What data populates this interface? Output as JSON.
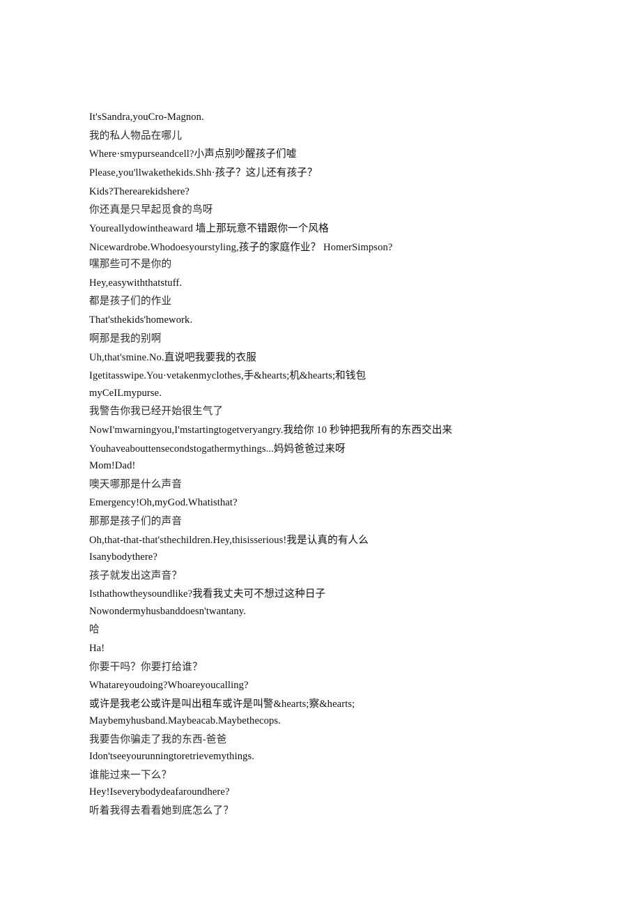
{
  "document": {
    "kind": "bilingual-subtitle-transcript",
    "page_background": "#ffffff",
    "text_color": "#000000",
    "lines": [
      {
        "text": "It'sSandra,youCro-Magnon.",
        "lang": "en",
        "style": "gap-tight"
      },
      {
        "text": "我的私人物品在哪儿",
        "lang": "zh",
        "style": "gap-loose"
      },
      {
        "text": "Where·smypurseandcell?小声点别吵醒孩子们嘘",
        "lang": "mix",
        "style": "gap-loose"
      },
      {
        "text": "Please,you'llwakethekids.Shh·孩子？这儿还有孩子？",
        "lang": "mix",
        "style": "gap-loose"
      },
      {
        "text": "Kids?Therearekidshere?",
        "lang": "en",
        "style": "gap-loose"
      },
      {
        "text": "你还真是只早起觅食的鸟呀",
        "lang": "zh",
        "style": "gap-loose"
      },
      {
        "text": "Youreallydowintheaward 墙上那玩意不错跟你一个风格",
        "lang": "mix",
        "style": "gap-loose"
      },
      {
        "text": "Nicewardrobe.Whodoesyourstyling,孩子的家庭作业？ HomerSimpson?",
        "lang": "mix",
        "style": "gap-loose"
      },
      {
        "text": "嘿那些可不是你的",
        "lang": "zh",
        "style": "gap-tight"
      },
      {
        "text": "Hey,easywiththatstuff.",
        "lang": "en",
        "style": "gap-loose"
      },
      {
        "text": "都是孩子们的作业",
        "lang": "zh",
        "style": "gap-loose"
      },
      {
        "text": "That'sthekids'homework.",
        "lang": "en",
        "style": "gap-loose"
      },
      {
        "text": "啊那是我的别啊",
        "lang": "zh",
        "style": "gap-loose"
      },
      {
        "text": "Uh,that'smine.No.直说吧我要我的衣服",
        "lang": "mix",
        "style": "gap-loose"
      },
      {
        "text": "Igetitasswipe.You·vetakenmyclothes,手&hearts;机&hearts;和钱包",
        "lang": "mix",
        "style": "gap-loose"
      },
      {
        "text": "myCeILmypurse.",
        "lang": "en",
        "style": "gap-tight"
      },
      {
        "text": "我警告你我已经开始很生气了",
        "lang": "zh",
        "style": "gap-loose"
      },
      {
        "text": "NowI'mwarningyou,I'mstartingtogetveryangry.我给你 10 秒钟把我所有的东西交出来",
        "lang": "mix",
        "style": "gap-loose"
      },
      {
        "text": "Youhaveabouttensecondstogathermythings...妈妈爸爸过来呀",
        "lang": "mix",
        "style": "gap-loose"
      },
      {
        "text": "Mom!Dad!",
        "lang": "en",
        "style": "gap-tight"
      },
      {
        "text": "噢天哪那是什么声音",
        "lang": "zh",
        "style": "gap-loose"
      },
      {
        "text": "Emergency!Oh,myGod.Whatisthat?",
        "lang": "en",
        "style": "gap-loose"
      },
      {
        "text": "那那是孩子们的声音",
        "lang": "zh",
        "style": "gap-loose"
      },
      {
        "text": "Oh,that-that-that'sthechildren.Hey,thisisserious!我是认真的有人么",
        "lang": "mix",
        "style": "gap-loose"
      },
      {
        "text": "Isanybodythere?",
        "lang": "en",
        "style": "gap-tight"
      },
      {
        "text": "孩子就发出这声音？",
        "lang": "zh",
        "style": "gap-loose"
      },
      {
        "text": "Isthathowtheysoundlike?我看我丈夫可不想过这种日子",
        "lang": "mix",
        "style": "gap-loose"
      },
      {
        "text": "Nowondermyhusbanddoesn'twantany.",
        "lang": "en",
        "style": "gap-tight"
      },
      {
        "text": "哈",
        "lang": "zh",
        "style": "gap-loose"
      },
      {
        "text": "Ha!",
        "lang": "en",
        "style": "gap-loose"
      },
      {
        "text": "你要干吗？你要打给谁？",
        "lang": "zh",
        "style": "gap-loose"
      },
      {
        "text": "Whatareyoudoing?Whoareyoucalling?",
        "lang": "en",
        "style": "gap-loose"
      },
      {
        "text": "或许是我老公或许是叫出租车或许是叫警&hearts;察&hearts;",
        "lang": "mix",
        "style": "gap-loose"
      },
      {
        "text": "Maybemyhusband.Maybeacab.Maybethecops.",
        "lang": "en",
        "style": "gap-tight"
      },
      {
        "text": "我要告你骗走了我的东西-爸爸",
        "lang": "zh",
        "style": "gap-loose"
      },
      {
        "text": "Idon'tseeyourunningtoretrievemythings.",
        "lang": "en",
        "style": "gap-tight"
      },
      {
        "text": "谁能过来一下么？",
        "lang": "zh",
        "style": "gap-loose"
      },
      {
        "text": "Hey!Iseverybodydeafaroundhere?",
        "lang": "en",
        "style": "gap-tight"
      },
      {
        "text": "听着我得去看看她到底怎么了？",
        "lang": "zh",
        "style": "gap-loose"
      }
    ]
  }
}
